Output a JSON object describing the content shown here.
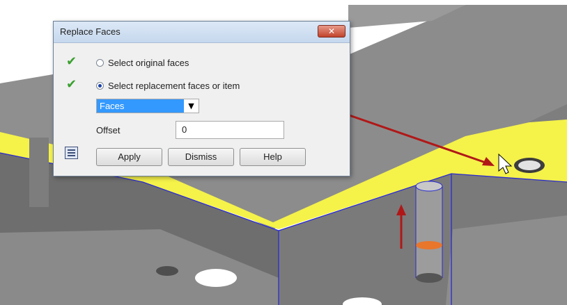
{
  "dialog": {
    "title": "Replace Faces",
    "close_label": "✕",
    "check_icon": "✔",
    "option_original": "Select original faces",
    "option_replacement": "Select replacement faces or item",
    "selected_option": "replacement",
    "filter_select": {
      "value": "Faces",
      "arrow": "▼"
    },
    "offset": {
      "label": "Offset",
      "value": "0"
    },
    "buttons": {
      "apply": "Apply",
      "dismiss": "Dismiss",
      "help": "Help"
    }
  },
  "colors": {
    "highlight_face": "#f5f24a",
    "model_gray": "#8a8a8a",
    "annotation_arrow": "#b01818",
    "selected_face": "#e8762b",
    "check_green": "#3aa02f"
  }
}
